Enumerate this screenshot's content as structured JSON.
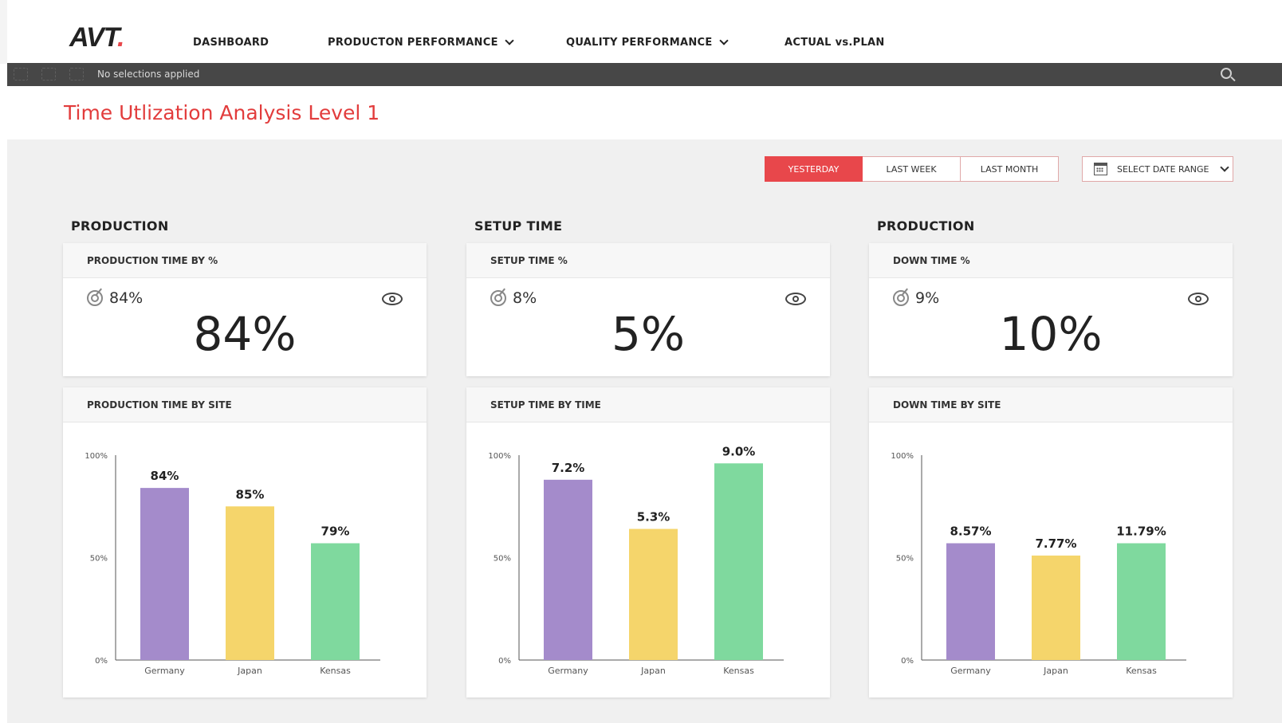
{
  "nav": {
    "logo_text": "AVT",
    "logo_dot": ".",
    "items": [
      {
        "label": "DASHBOARD"
      },
      {
        "label": "PRODUCTON PERFORMANCE"
      },
      {
        "label": "QUALITY PERFORMANCE"
      },
      {
        "label": "ACTUAL vs.PLAN"
      }
    ]
  },
  "selection_bar": {
    "text": "No selections applied"
  },
  "page_title": "Time Utlization Analysis Level 1",
  "filters": {
    "options": [
      "YESTERDAY",
      "LAST WEEK",
      "LAST MONTH"
    ],
    "active": "YESTERDAY",
    "date_range_label": "SELECT DATE RANGE"
  },
  "columns": [
    {
      "title": "PRODUCTION",
      "kpi": {
        "header": "PRODUCTION TIME BY %",
        "target": "84%",
        "value": "84%"
      },
      "chart_header": "PRODUCTION TIME BY SITE"
    },
    {
      "title": "SETUP TIME",
      "kpi": {
        "header": "SETUP TIME %",
        "target": "8%",
        "value": "5%"
      },
      "chart_header": "SETUP TIME BY TIME"
    },
    {
      "title": "PRODUCTION",
      "kpi": {
        "header": "DOWN TIME %",
        "target": "9%",
        "value": "10%"
      },
      "chart_header": "DOWN TIME BY SITE"
    }
  ],
  "colors": {
    "accent": "#e8474b",
    "bar_germany": "#a48bcb",
    "bar_japan": "#f5d56b",
    "bar_kensas": "#7fd99e"
  },
  "chart_data": [
    {
      "type": "bar",
      "categories": [
        "Germany",
        "Japan",
        "Kensas"
      ],
      "values": [
        84,
        85,
        79
      ],
      "bar_heights_pct": [
        84,
        75,
        57
      ],
      "labels": [
        "84%",
        "85%",
        "79%"
      ],
      "yticks": [
        "100%",
        "50%",
        "0%"
      ],
      "ylim": [
        0,
        100
      ]
    },
    {
      "type": "bar",
      "categories": [
        "Germany",
        "Japan",
        "Kensas"
      ],
      "values": [
        7.2,
        5.3,
        9.0
      ],
      "bar_heights_pct": [
        88,
        64,
        96
      ],
      "labels": [
        "7.2%",
        "5.3%",
        "9.0%"
      ],
      "yticks": [
        "100%",
        "50%",
        "0%"
      ],
      "ylim": [
        0,
        100
      ]
    },
    {
      "type": "bar",
      "categories": [
        "Germany",
        "Japan",
        "Kensas"
      ],
      "values": [
        8.57,
        7.77,
        11.79
      ],
      "bar_heights_pct": [
        57,
        51,
        57
      ],
      "labels": [
        "8.57%",
        "7.77%",
        "11.79%"
      ],
      "yticks": [
        "100%",
        "50%",
        "0%"
      ],
      "ylim": [
        0,
        100
      ]
    }
  ]
}
